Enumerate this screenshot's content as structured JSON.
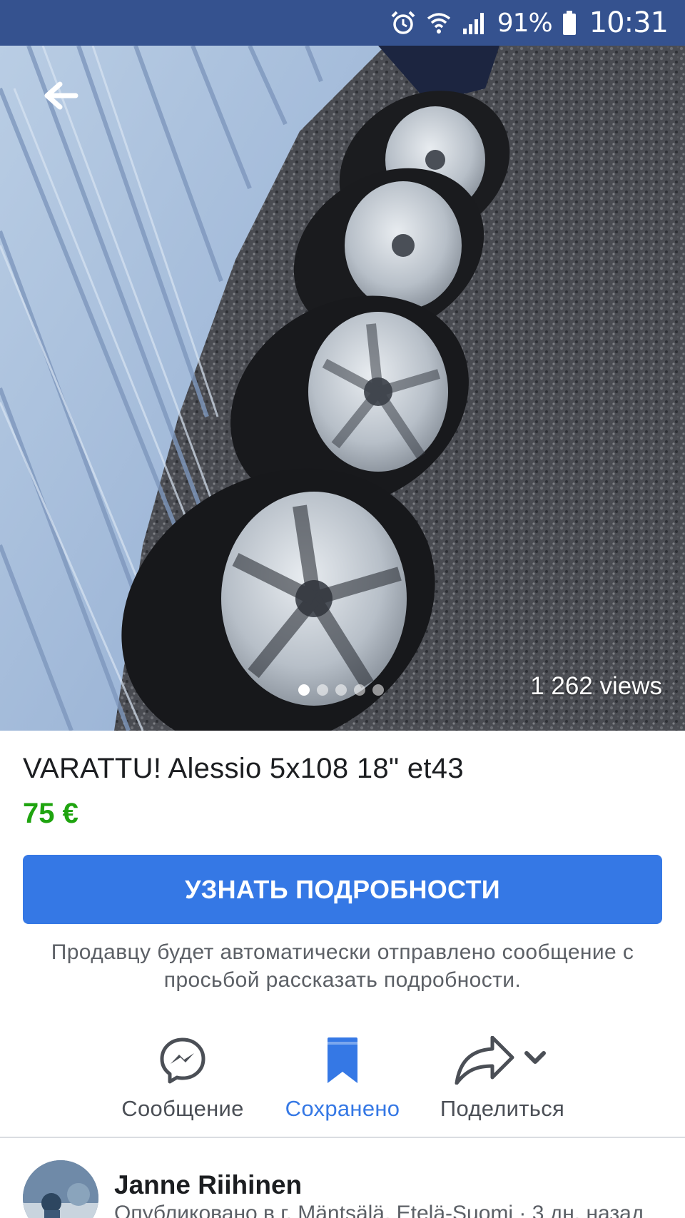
{
  "status_bar": {
    "icons": [
      "alarm-icon",
      "wifi-icon",
      "signal-icon",
      "battery-icon"
    ],
    "battery_percent": "91%",
    "time": "10:31"
  },
  "gallery": {
    "back_icon": "arrow-left-icon",
    "photo_count": 5,
    "active_photo": 1,
    "views_text": "1 262 views"
  },
  "listing": {
    "title": "VARATTU! Alessio 5x108 18\" et43",
    "price": "75 €",
    "cta_label": "УЗНАТЬ ПОДРОБНОСТИ",
    "hint": "Продавцу будет автоматически отправлено сообщение с просьбой рассказать подробности."
  },
  "actions": [
    {
      "label": "Сообщение",
      "icon": "messenger-icon",
      "active": false
    },
    {
      "label": "Сохранено",
      "icon": "bookmark-icon",
      "active": true
    },
    {
      "label": "Поделиться",
      "icon": "share-icon",
      "active": false
    }
  ],
  "seller": {
    "name": "Janne Riihinen",
    "meta": "Опубликовано в г. Mäntsälä, Etelä-Suomi · 3 дн. назад"
  },
  "colors": {
    "status_bar": "#35528f",
    "accent": "#3578e5",
    "price": "#1fa40f"
  }
}
